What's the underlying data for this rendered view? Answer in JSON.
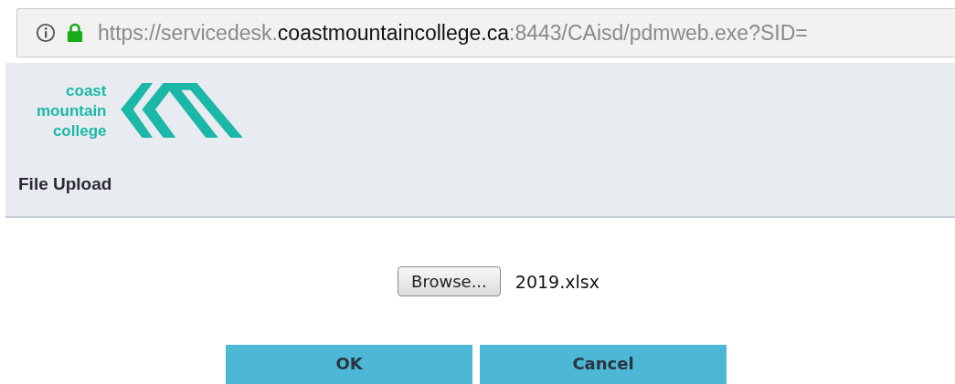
{
  "address_bar": {
    "url": [
      {
        "text": "https://servicedesk.",
        "highlight": false
      },
      {
        "text": "coastmountaincollege.ca",
        "highlight": true
      },
      {
        "text": ":8443/CAisd/pdmweb.exe?SID=",
        "highlight": false
      }
    ],
    "secure": true
  },
  "logo": {
    "lines": [
      "coast",
      "mountain",
      "college"
    ]
  },
  "page_title": "File Upload",
  "upload": {
    "button": "Browse...",
    "file_name": "2019.xlsx"
  },
  "buttons": [
    "OK",
    "Cancel"
  ]
}
